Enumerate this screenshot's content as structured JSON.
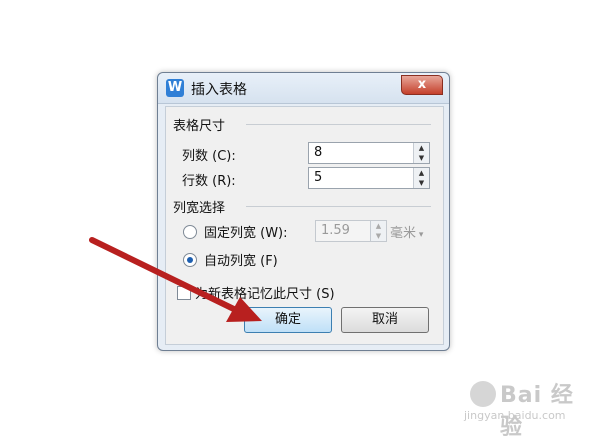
{
  "dialog": {
    "title": "插入表格",
    "close_label": "x",
    "app_icon_label": "W",
    "table_size_group": "表格尺寸",
    "columns_label": "列数 (C):",
    "columns_value": "8",
    "rows_label": "行数 (R):",
    "rows_value": "5",
    "column_width_group": "列宽选择",
    "fixed_width_label": "固定列宽 (W):",
    "fixed_width_value": "1.59",
    "unit_label": "毫米",
    "auto_width_label": "自动列宽 (F)",
    "selected_width_mode": "auto",
    "remember_label": "为新表格记忆此尺寸 (S)",
    "remember_checked": false,
    "ok_label": "确定",
    "cancel_label": "取消"
  },
  "watermark": {
    "logo_text": "Bai 经验",
    "url_text": "jingyan.baidu.com"
  },
  "colors": {
    "accent": "#2f7fd6",
    "arrow": "#b8201f",
    "close": "#c4402b"
  }
}
